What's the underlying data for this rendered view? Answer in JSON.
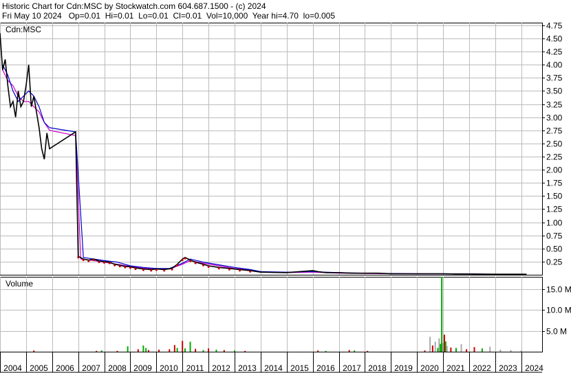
{
  "header": {
    "line1": "Historic Chart for Cdn:MSC by Stockwatch.com 604.687.1500 - (c) 2024",
    "line2": "Fri May 10 2024   Op=0.01  Hi=0.01  Lo=0.01  Cl=0.01  Vol=10,000  Year hi=4.70  lo=0.005"
  },
  "chart_data": [
    {
      "type": "line",
      "panel": "price",
      "label": "Cdn:MSC",
      "y_ticks": [
        "4.75",
        "4.50",
        "4.25",
        "4.00",
        "3.75",
        "3.50",
        "3.25",
        "3.00",
        "2.75",
        "2.50",
        "2.25",
        "2.00",
        "1.75",
        "1.50",
        "1.25",
        "1.00",
        "0.75",
        "0.50",
        "0.25"
      ],
      "ylim": [
        0,
        4.8
      ],
      "x_ticks": [
        "2004",
        "2005",
        "2006",
        "2007",
        "2008",
        "2009",
        "2010",
        "2011",
        "2012",
        "2013",
        "2014",
        "2015",
        "2016",
        "2017",
        "2018",
        "2019",
        "2020",
        "2021",
        "2022",
        "2023",
        "2024"
      ],
      "grid": true,
      "series": [
        {
          "color": "#000000",
          "x": [
            2004.0,
            2004.1,
            2004.2,
            2004.3,
            2004.4,
            2004.5,
            2004.6,
            2004.7,
            2004.8,
            2004.9,
            2005.0,
            2005.1,
            2005.2,
            2005.3,
            2005.4,
            2005.5,
            2005.6,
            2005.7,
            2005.8,
            2005.9,
            2006.9,
            2007.0,
            2007.2,
            2007.4,
            2007.6,
            2007.8,
            2008.0,
            2008.2,
            2008.4,
            2008.6,
            2008.8,
            2009.0,
            2009.2,
            2009.5,
            2009.8,
            2010.0,
            2010.3,
            2010.6,
            2010.8,
            2011.0,
            2011.1,
            2011.3,
            2011.5,
            2011.8,
            2012.0,
            2012.4,
            2012.8,
            2013.2,
            2013.6,
            2014.0,
            2015.0,
            2016.0,
            2016.2,
            2016.5,
            2017.0,
            2017.5,
            2018.0,
            2018.5,
            2019.0,
            2019.5,
            2020.0,
            2020.5,
            2021.0,
            2021.5,
            2022.0,
            2022.5,
            2023.0,
            2023.5,
            2024.2
          ],
          "values": [
            4.6,
            3.9,
            4.1,
            3.6,
            3.2,
            3.3,
            3.0,
            3.5,
            3.2,
            3.3,
            3.6,
            4.0,
            3.2,
            3.4,
            3.1,
            2.8,
            2.4,
            2.2,
            2.7,
            2.4,
            2.72,
            0.35,
            0.3,
            0.28,
            0.3,
            0.26,
            0.25,
            0.24,
            0.2,
            0.18,
            0.16,
            0.15,
            0.13,
            0.11,
            0.1,
            0.11,
            0.1,
            0.12,
            0.2,
            0.3,
            0.33,
            0.28,
            0.24,
            0.2,
            0.17,
            0.14,
            0.12,
            0.1,
            0.08,
            0.05,
            0.04,
            0.08,
            0.06,
            0.04,
            0.04,
            0.03,
            0.03,
            0.03,
            0.02,
            0.02,
            0.02,
            0.02,
            0.02,
            0.015,
            0.015,
            0.01,
            0.01,
            0.01,
            0.01
          ]
        },
        {
          "color": "#0000cc",
          "x": [
            2004.1,
            2004.3,
            2004.5,
            2004.7,
            2004.9,
            2005.1,
            2005.3,
            2005.5,
            2005.7,
            2005.9,
            2006.9,
            2007.2,
            2007.6,
            2008.0,
            2008.5,
            2009.0,
            2009.5,
            2010.0,
            2010.5,
            2011.0,
            2011.3,
            2011.8,
            2012.4,
            2013.0,
            2013.6,
            2014.0,
            2015.0,
            2016.0,
            2016.5,
            2017.0,
            2018.0,
            2019.0,
            2020.0,
            2021.0,
            2022.0,
            2023.0,
            2024.2
          ],
          "values": [
            4.0,
            3.8,
            3.5,
            3.3,
            3.4,
            3.5,
            3.4,
            3.2,
            2.9,
            2.8,
            2.72,
            0.33,
            0.3,
            0.27,
            0.24,
            0.17,
            0.14,
            0.12,
            0.12,
            0.22,
            0.3,
            0.24,
            0.19,
            0.14,
            0.1,
            0.06,
            0.05,
            0.06,
            0.05,
            0.04,
            0.03,
            0.025,
            0.02,
            0.02,
            0.018,
            0.012,
            0.01
          ]
        },
        {
          "color": "#cc00cc",
          "x": [
            2004.1,
            2004.3,
            2004.5,
            2004.7,
            2004.9,
            2005.1,
            2005.3,
            2005.5,
            2005.7,
            2005.9,
            2006.9,
            2007.1,
            2007.6,
            2008.0,
            2008.5,
            2009.0,
            2009.5,
            2010.0,
            2010.5,
            2011.0,
            2011.3,
            2011.8,
            2012.4,
            2013.0,
            2013.6,
            2014.0,
            2015.0,
            2016.0,
            2016.5,
            2017.0,
            2018.0,
            2019.0,
            2020.0,
            2021.0,
            2022.0,
            2023.0,
            2024.2
          ],
          "values": [
            3.9,
            3.7,
            3.6,
            3.4,
            3.3,
            3.3,
            3.2,
            3.1,
            2.9,
            2.75,
            2.65,
            0.3,
            0.27,
            0.24,
            0.2,
            0.16,
            0.13,
            0.11,
            0.11,
            0.2,
            0.27,
            0.22,
            0.17,
            0.12,
            0.09,
            0.05,
            0.04,
            0.05,
            0.04,
            0.03,
            0.025,
            0.02,
            0.018,
            0.017,
            0.015,
            0.011,
            0.01
          ]
        }
      ]
    },
    {
      "type": "bar",
      "panel": "volume",
      "label": "Volume",
      "y_ticks": [
        "15.0 M",
        "10.0 M",
        "5.0 M"
      ],
      "ylim": [
        0,
        18
      ],
      "unit": "M",
      "grid": true,
      "bars": [
        {
          "x": 2005.3,
          "v": 0.3,
          "c": "r"
        },
        {
          "x": 2007.7,
          "v": 0.2,
          "c": "r"
        },
        {
          "x": 2007.9,
          "v": 0.3,
          "c": "g"
        },
        {
          "x": 2008.5,
          "v": 0.2,
          "c": "r"
        },
        {
          "x": 2008.9,
          "v": 1.3,
          "c": "g"
        },
        {
          "x": 2009.3,
          "v": 0.6,
          "c": "r"
        },
        {
          "x": 2009.5,
          "v": 1.5,
          "c": "g"
        },
        {
          "x": 2009.6,
          "v": 0.9,
          "c": "g"
        },
        {
          "x": 2009.7,
          "v": 0.4,
          "c": "r"
        },
        {
          "x": 2010.1,
          "v": 0.5,
          "c": "r"
        },
        {
          "x": 2010.5,
          "v": 0.6,
          "c": "r"
        },
        {
          "x": 2010.7,
          "v": 1.6,
          "c": "r"
        },
        {
          "x": 2010.8,
          "v": 0.9,
          "c": "g"
        },
        {
          "x": 2011.0,
          "v": 2.6,
          "c": "r"
        },
        {
          "x": 2011.1,
          "v": 0.8,
          "c": "g"
        },
        {
          "x": 2011.3,
          "v": 2.4,
          "c": "g"
        },
        {
          "x": 2011.5,
          "v": 0.7,
          "c": "r"
        },
        {
          "x": 2011.8,
          "v": 0.4,
          "c": "g"
        },
        {
          "x": 2012.0,
          "v": 0.8,
          "c": "r"
        },
        {
          "x": 2012.3,
          "v": 0.5,
          "c": "g"
        },
        {
          "x": 2012.6,
          "v": 0.4,
          "c": "r"
        },
        {
          "x": 2013.0,
          "v": 0.3,
          "c": "g"
        },
        {
          "x": 2013.4,
          "v": 0.2,
          "c": "r"
        },
        {
          "x": 2016.2,
          "v": 0.3,
          "c": "r"
        },
        {
          "x": 2016.5,
          "v": 0.2,
          "c": "g"
        },
        {
          "x": 2017.4,
          "v": 0.4,
          "c": "r"
        },
        {
          "x": 2017.6,
          "v": 0.3,
          "c": "g"
        },
        {
          "x": 2018.1,
          "v": 0.2,
          "c": "r"
        },
        {
          "x": 2020.3,
          "v": 0.3,
          "c": "r"
        },
        {
          "x": 2020.5,
          "v": 3.6,
          "c": "k"
        },
        {
          "x": 2020.6,
          "v": 1.5,
          "c": "r"
        },
        {
          "x": 2020.7,
          "v": 2.4,
          "c": "k"
        },
        {
          "x": 2020.8,
          "v": 0.9,
          "c": "g"
        },
        {
          "x": 2020.85,
          "v": 3.2,
          "c": "k"
        },
        {
          "x": 2020.9,
          "v": 1.9,
          "c": "g"
        },
        {
          "x": 2020.95,
          "v": 18.5,
          "c": "g"
        },
        {
          "x": 2021.0,
          "v": 2.1,
          "c": "k"
        },
        {
          "x": 2021.05,
          "v": 4.1,
          "c": "r"
        },
        {
          "x": 2021.1,
          "v": 2.5,
          "c": "g"
        },
        {
          "x": 2021.15,
          "v": 1.4,
          "c": "k"
        },
        {
          "x": 2021.3,
          "v": 1.0,
          "c": "r"
        },
        {
          "x": 2021.5,
          "v": 0.9,
          "c": "g"
        },
        {
          "x": 2021.7,
          "v": 1.8,
          "c": "k"
        },
        {
          "x": 2021.9,
          "v": 0.6,
          "c": "r"
        },
        {
          "x": 2022.2,
          "v": 1.1,
          "c": "r"
        },
        {
          "x": 2022.5,
          "v": 0.8,
          "c": "g"
        },
        {
          "x": 2022.8,
          "v": 1.2,
          "c": "k"
        },
        {
          "x": 2023.2,
          "v": 0.5,
          "c": "k"
        },
        {
          "x": 2023.6,
          "v": 0.4,
          "c": "k"
        },
        {
          "x": 2024.0,
          "v": 0.3,
          "c": "k"
        }
      ]
    }
  ]
}
